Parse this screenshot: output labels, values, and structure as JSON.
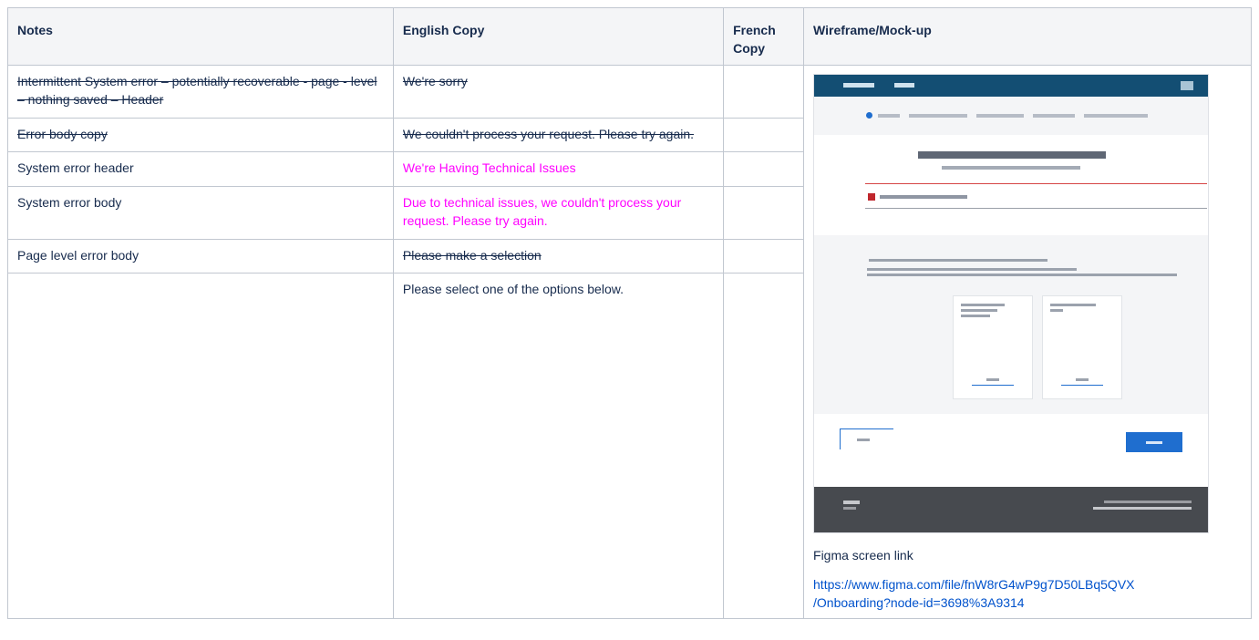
{
  "headers": {
    "notes": "Notes",
    "english": "English Copy",
    "french": "French Copy",
    "wireframe": "Wireframe/Mock-up"
  },
  "rows": [
    {
      "notes": "Intermittent System error – potentially recoverable - page - level – nothing saved – Header",
      "english": "We're sorry",
      "french": ""
    },
    {
      "notes": "Error body copy",
      "english": "We couldn't process your request. Please try again.",
      "french": ""
    },
    {
      "notes": "System error header",
      "english": "We're Having Technical Issues",
      "french": ""
    },
    {
      "notes": "System error body",
      "english": "Due to technical issues, we couldn't process your request. Please try again.",
      "french": ""
    },
    {
      "notes": "Page level error body",
      "english": "Please make a selection",
      "french": ""
    },
    {
      "notes": "",
      "english": "Please select one of the options below.",
      "french": ""
    }
  ],
  "wireframe": {
    "figma_label": "Figma screen link",
    "figma_url_line1": "https://www.figma.com/file/fnW8rG4wP9g7D50LBq5QVX",
    "figma_url_line2": "/Onboarding?node-id=3698%3A9314"
  },
  "colors": {
    "accent": "#ff00ff",
    "link": "#0052cc",
    "header_bg": "#f4f5f7",
    "border": "#c1c7d0",
    "mock_topbar": "#134e73",
    "mock_primary": "#1f6ecf",
    "mock_footer": "#474a4f",
    "mock_error": "#c0272d"
  }
}
